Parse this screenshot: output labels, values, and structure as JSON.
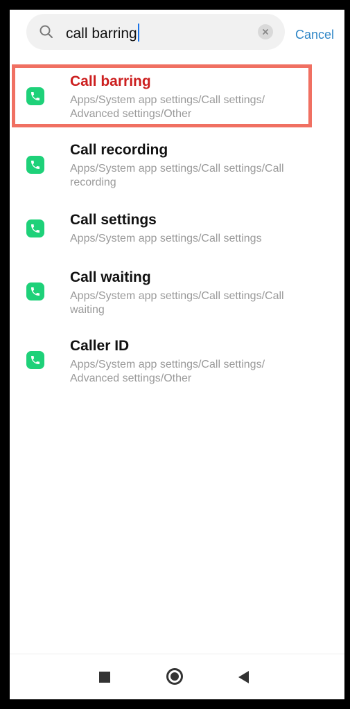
{
  "search": {
    "query": "call barring",
    "cancel_label": "Cancel"
  },
  "results": [
    {
      "title": "Call barring",
      "path": "Apps/System app settings/Call settings/ Advanced settings/Other",
      "icon": "phone-icon",
      "highlighted": true
    },
    {
      "title": "Call recording",
      "path": "Apps/System app settings/Call settings/Call recording",
      "icon": "phone-icon"
    },
    {
      "title": "Call settings",
      "path": "Apps/System app settings/Call settings",
      "icon": "phone-icon"
    },
    {
      "title": "Call waiting",
      "path": "Apps/System app settings/Call settings/Call waiting",
      "icon": "phone-icon"
    },
    {
      "title": "Caller ID",
      "path": "Apps/System app settings/Call settings/ Advanced settings/Other",
      "icon": "phone-icon"
    }
  ],
  "navbar": {
    "icons": [
      "recents-square-icon",
      "home-circle-icon",
      "back-triangle-icon"
    ]
  },
  "colors": {
    "accent": "#2f86c6",
    "app_icon": "#1ed179",
    "highlight_border": "#f07062",
    "highlight_title": "#cc1f1f"
  }
}
